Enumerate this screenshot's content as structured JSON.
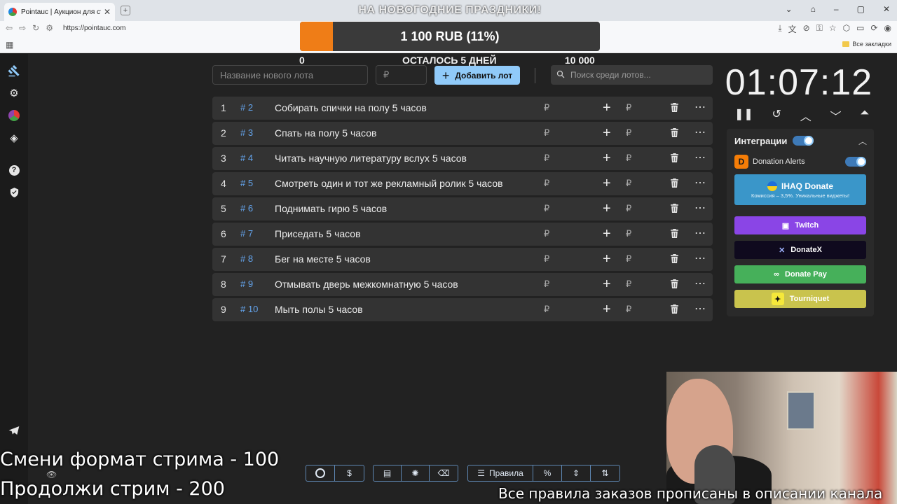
{
  "browser": {
    "tab_title": "Pointauc | Аукцион для стримеров",
    "url": "https://pointauc.com",
    "bookmarks_label": "Все закладки"
  },
  "goal": {
    "title": "НА НОВОГОДНИЕ ПРАЗДНИКИ!",
    "progress_label": "1 100 RUB (11%)",
    "progress_fraction": 0.11,
    "min_label": "0",
    "days_left_label": "ОСТАЛОСЬ 5 ДНЕЙ",
    "max_label": "10 000",
    "fill_color": "#ef7d17"
  },
  "controls": {
    "new_lot_placeholder": "Название нового лота",
    "amount_placeholder": "₽",
    "add_lot_label": "Добавить лот",
    "search_placeholder": "Поиск среди лотов..."
  },
  "lots": [
    {
      "index": "1",
      "fast_id": "# 2",
      "name": "Собирать спички на полу 5 часов",
      "amount": "₽"
    },
    {
      "index": "2",
      "fast_id": "# 3",
      "name": "Спать на полу 5 часов",
      "amount": "₽"
    },
    {
      "index": "3",
      "fast_id": "# 4",
      "name": "Читать научную литературу вслух 5 часов",
      "amount": "₽"
    },
    {
      "index": "4",
      "fast_id": "# 5",
      "name": "Смотреть один и тот же рекламный ролик 5 часов",
      "amount": "₽"
    },
    {
      "index": "5",
      "fast_id": "# 6",
      "name": "Поднимать гирю 5 часов",
      "amount": "₽"
    },
    {
      "index": "6",
      "fast_id": "# 7",
      "name": "Приседать 5 часов",
      "amount": "₽"
    },
    {
      "index": "7",
      "fast_id": "# 8",
      "name": "Бег на месте 5 часов",
      "amount": "₽"
    },
    {
      "index": "8",
      "fast_id": "# 9",
      "name": "Отмывать дверь межкомнатную 5 часов",
      "amount": "₽"
    },
    {
      "index": "9",
      "fast_id": "# 10",
      "name": "Мыть полы 5 часов",
      "amount": "₽"
    }
  ],
  "timer": {
    "value": "01:07:12"
  },
  "integrations": {
    "title": "Интеграции",
    "donation_alerts": "Donation Alerts",
    "ihaq_label": "IHAQ Donate",
    "ihaq_sub": "Комиссия – 3,5%. Уникальные виджеты!",
    "twitch": "Twitch",
    "donatex": "DonateX",
    "donatepay": "Donate Pay",
    "tourniquet": "Tourniquet"
  },
  "toolbar": {
    "rules_label": "Правила"
  },
  "overlay": {
    "line1": "Смени формат стрима - 100",
    "line2": "Продолжи стрим - 200",
    "line3": "Все правила заказов прописаны в описании канала"
  },
  "icons": {
    "sidebar": [
      "gavel-icon",
      "gear-icon",
      "pie-chart-icon",
      "layers-icon",
      "help-icon",
      "shield-icon",
      "telegram-icon"
    ],
    "toolbar": [
      "github-icon",
      "dollar-icon",
      "save-icon",
      "bug-icon",
      "clear-icon",
      "rules-icon",
      "percent-icon",
      "compress-icon",
      "sort-icon"
    ]
  }
}
